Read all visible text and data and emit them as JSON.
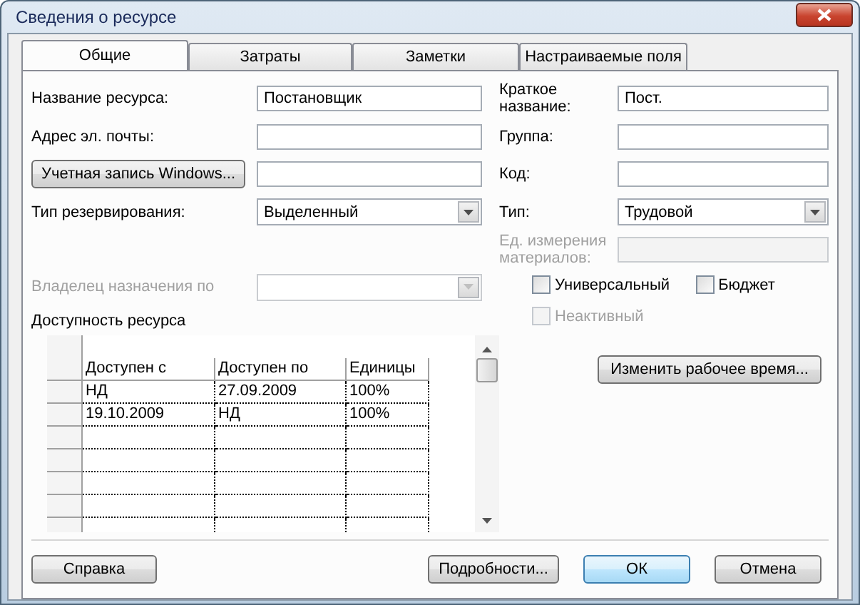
{
  "window": {
    "title": "Сведения о ресурсе"
  },
  "tabs": [
    {
      "label": "Общие",
      "selected": true
    },
    {
      "label": "Затраты",
      "selected": false
    },
    {
      "label": "Заметки",
      "selected": false
    },
    {
      "label": "Настраиваемые поля",
      "selected": false
    }
  ],
  "left_fields": [
    {
      "kind": "text",
      "label": "Название ресурса:",
      "value": "Постановщик",
      "disabled": false
    },
    {
      "kind": "text",
      "label": "Адрес эл. почты:",
      "disabled": false
    },
    {
      "kind": "button",
      "label": "Учетная запись Windows...",
      "disabled": false
    },
    {
      "kind": "combo",
      "label": "Тип резервирования:",
      "value": "Выделенный",
      "disabled": false
    },
    {
      "kind": "combo",
      "label": "Владелец назначения по",
      "disabled": true
    }
  ],
  "right_fields": [
    {
      "kind": "text",
      "label": "Краткое название:",
      "value": "Пост.",
      "disabled": false
    },
    {
      "kind": "text",
      "label": "Группа:",
      "disabled": false
    },
    {
      "kind": "text",
      "label": "Код:",
      "disabled": false
    },
    {
      "kind": "combo",
      "label": "Тип:",
      "value": "Трудовой",
      "disabled": false
    },
    {
      "kind": "text",
      "label": "Ед. измерения материалов:",
      "disabled": true
    }
  ],
  "checkboxes": [
    {
      "label": "Универсальный",
      "checked": false,
      "disabled": false
    },
    {
      "label": "Бюджет",
      "checked": false,
      "disabled": false
    },
    {
      "label": "Неактивный",
      "checked": false,
      "disabled": true
    }
  ],
  "change_work_time_button": "Изменить рабочее время...",
  "availability": {
    "title": "Доступность ресурса",
    "columns": [
      "Доступен с",
      "Доступен по",
      "Единицы"
    ],
    "rows": [
      [
        "НД",
        "27.09.2009",
        "100%"
      ],
      [
        "19.10.2009",
        "НД",
        "100%"
      ]
    ]
  },
  "buttons": {
    "help": "Справка",
    "details": "Подробности...",
    "ok": "ОК",
    "cancel": "Отмена"
  }
}
